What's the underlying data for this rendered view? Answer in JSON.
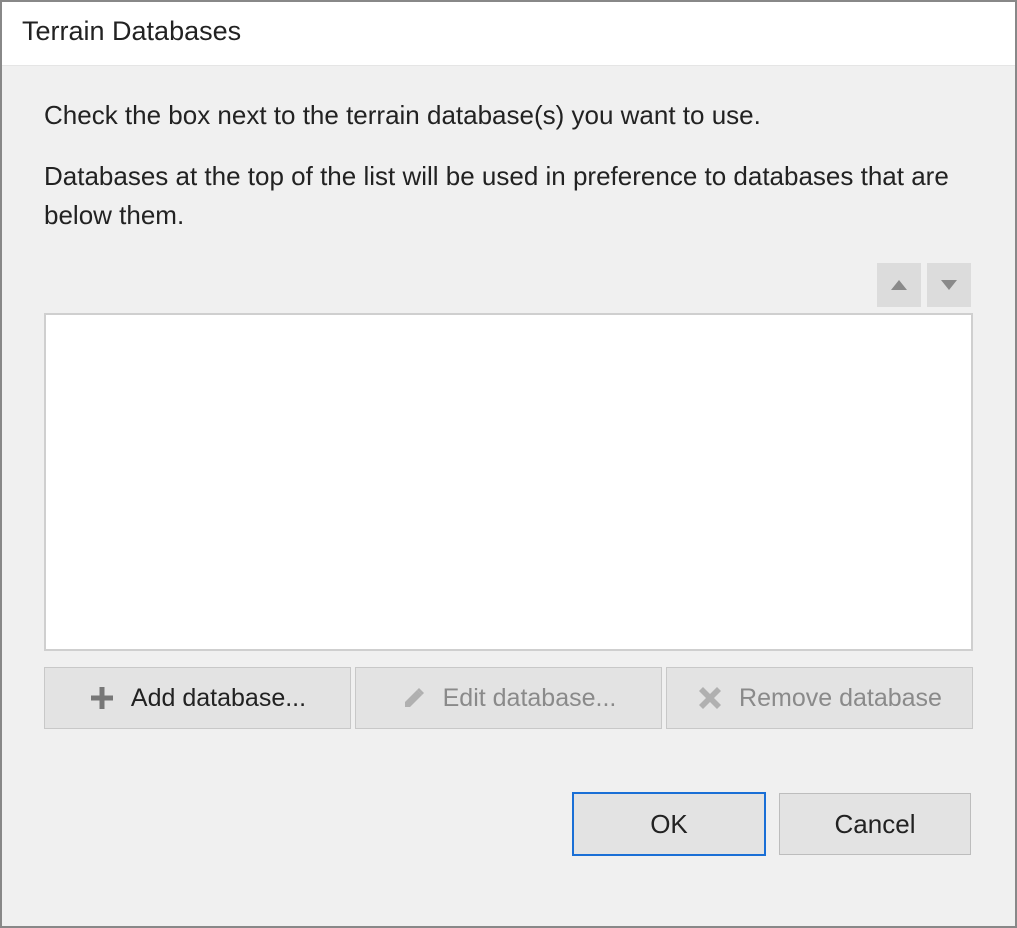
{
  "title": "Terrain Databases",
  "instructions": {
    "line1": "Check the box next to the terrain database(s) you want to use.",
    "line2": "Databases at the top of the list will be used in preference to databases that are below them."
  },
  "databases": [],
  "actions": {
    "add_label": "Add database...",
    "edit_label": "Edit database...",
    "remove_label": "Remove database"
  },
  "footer": {
    "ok_label": "OK",
    "cancel_label": "Cancel"
  }
}
